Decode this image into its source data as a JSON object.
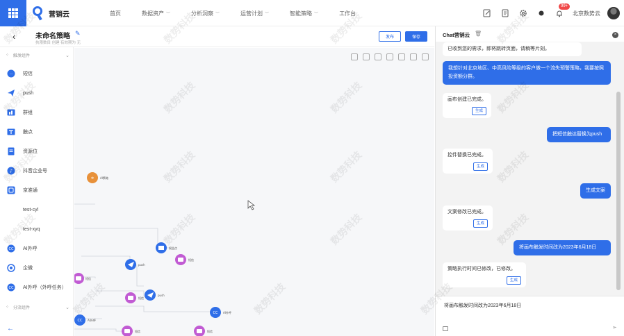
{
  "app": {
    "name": "营销云"
  },
  "nav": [
    {
      "label": "首页",
      "has_menu": false
    },
    {
      "label": "数据资产",
      "has_menu": true
    },
    {
      "label": "分析洞察",
      "has_menu": true
    },
    {
      "label": "运营计划",
      "has_menu": true
    },
    {
      "label": "智能策略",
      "has_menu": true
    },
    {
      "label": "工作台",
      "has_menu": false
    }
  ],
  "top": {
    "notification_badge": "99+",
    "org_name": "北京数势云"
  },
  "strategy": {
    "title": "未命名策略",
    "meta": "执限数目 创建    有效期为 无",
    "publish_label": "发布",
    "save_label": "保存"
  },
  "sidebar": {
    "section_trigger": "触发组件",
    "section_split": "分流组件",
    "items": [
      {
        "label": "短信",
        "icon": "sms-icon"
      },
      {
        "label": "push",
        "icon": "push-icon"
      },
      {
        "label": "群组",
        "icon": "group-icon"
      },
      {
        "label": "触点",
        "icon": "touchpoint-icon"
      },
      {
        "label": "资源位",
        "icon": "resource-slot-icon"
      },
      {
        "label": "抖音企业号",
        "icon": "douyin-icon"
      },
      {
        "label": "京准通",
        "icon": "jd-icon"
      },
      {
        "label": "test-cyl",
        "icon": ""
      },
      {
        "label": "test-xyq",
        "icon": ""
      },
      {
        "label": "AI外呼",
        "icon": "ai-call-icon"
      },
      {
        "label": "企微",
        "icon": "wecom-icon"
      },
      {
        "label": "AI外呼（外呼任务）",
        "icon": "ai-call-task-icon"
      }
    ]
  },
  "canvas": {
    "nodes": [
      {
        "label": "AI策略",
        "kind": "orange"
      },
      {
        "label": "权益点",
        "kind": "blue"
      },
      {
        "label": "push",
        "kind": "blue"
      },
      {
        "label": "短信",
        "kind": "purple"
      },
      {
        "label": "短信",
        "kind": "purple"
      },
      {
        "label": "短信",
        "kind": "purple"
      },
      {
        "label": "push",
        "kind": "blue"
      },
      {
        "label": "AI外呼",
        "kind": "blue"
      },
      {
        "label": "AI外呼",
        "kind": "blue"
      },
      {
        "label": "短信",
        "kind": "purple"
      },
      {
        "label": "短信",
        "kind": "purple"
      }
    ]
  },
  "chat": {
    "title": "Chat营销云",
    "messages": [
      {
        "role": "bot",
        "text": "已收到您的需求，即将跳转页面，请稍等片刻。"
      },
      {
        "role": "user",
        "text": "我想针对北京地区、中高风险等级的客户做一个流失预警策略，我要按照投资额分群。"
      },
      {
        "role": "bot",
        "text": "画布创建已完成。",
        "action": "生成"
      },
      {
        "role": "user",
        "text": "把短信触达替换为push"
      },
      {
        "role": "bot",
        "text": "控件替换已完成。",
        "action": "生成"
      },
      {
        "role": "user",
        "text": "生成文案"
      },
      {
        "role": "bot",
        "text": "文案修改已完成。",
        "action": "生成"
      },
      {
        "role": "user",
        "text": "将画布触发时间改为2023年6月18日"
      },
      {
        "role": "bot",
        "text": "策略执行时间已修改，已修改。",
        "action": "生成"
      }
    ],
    "input_value": "将画布触发时间改为2023年6月18日"
  },
  "watermark": "数势科技",
  "colors": {
    "primary": "#2f6ee8",
    "node_orange": "#e8913a",
    "node_purple": "#c15bd3",
    "node_blue": "#2f6ee8"
  }
}
